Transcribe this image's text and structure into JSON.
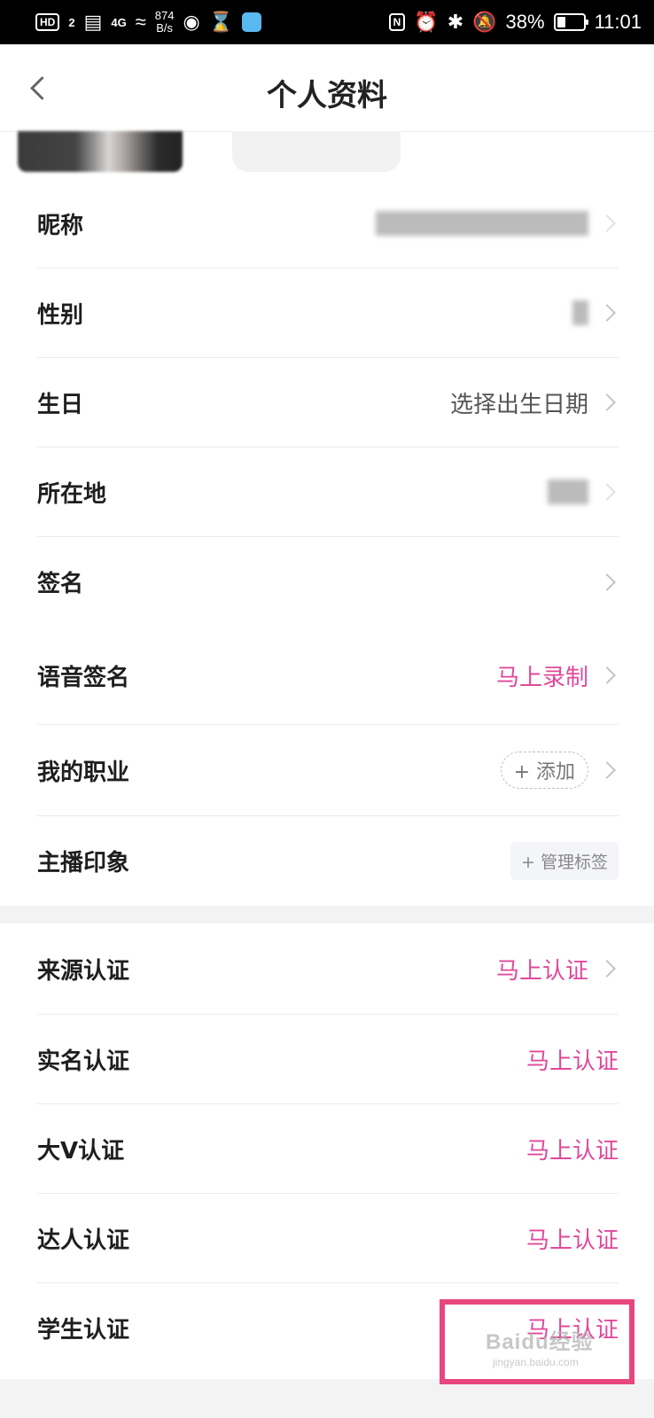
{
  "status_bar": {
    "hd_badge": "HD",
    "sim_num": "2",
    "net_4g": "4G",
    "speed_value": "874",
    "speed_unit": "B/s",
    "nfc": "N",
    "battery_pct": "38%",
    "time": "11:01",
    "icons": [
      "signal-icon",
      "wifi-icon",
      "eye-icon",
      "hourglass-icon",
      "app-icon",
      "nfc-icon",
      "alarm-icon",
      "bluetooth-icon",
      "mute-icon",
      "battery-icon"
    ]
  },
  "nav": {
    "title": "个人资料"
  },
  "rows": [
    {
      "label": "昵称",
      "value": "",
      "blurred": true
    },
    {
      "label": "性别",
      "value": "",
      "blurred": true
    },
    {
      "label": "生日",
      "value": "选择出生日期"
    },
    {
      "label": "所在地",
      "value": "",
      "blurred": true
    },
    {
      "label": "签名",
      "value": ""
    },
    {
      "label": "语音签名",
      "value": "马上录制"
    },
    {
      "label": "我的职业",
      "value": "+ 添加"
    },
    {
      "label": "主播印象",
      "value": "+ 管理标签"
    }
  ],
  "cert_rows": [
    {
      "label": "来源认证",
      "value": "马上认证"
    },
    {
      "label": "实名认证",
      "value": "马上认证"
    },
    {
      "label": "大V认证",
      "value": "马上认证"
    },
    {
      "label": "达人认证",
      "value": "马上认证"
    },
    {
      "label": "学生认证",
      "value": "马上认证"
    }
  ],
  "watermark": {
    "text": "Baidu经验",
    "sub": "jingyan.baidu.com"
  },
  "colors": {
    "accent": "#e0489b",
    "highlight": "#e8467f"
  }
}
